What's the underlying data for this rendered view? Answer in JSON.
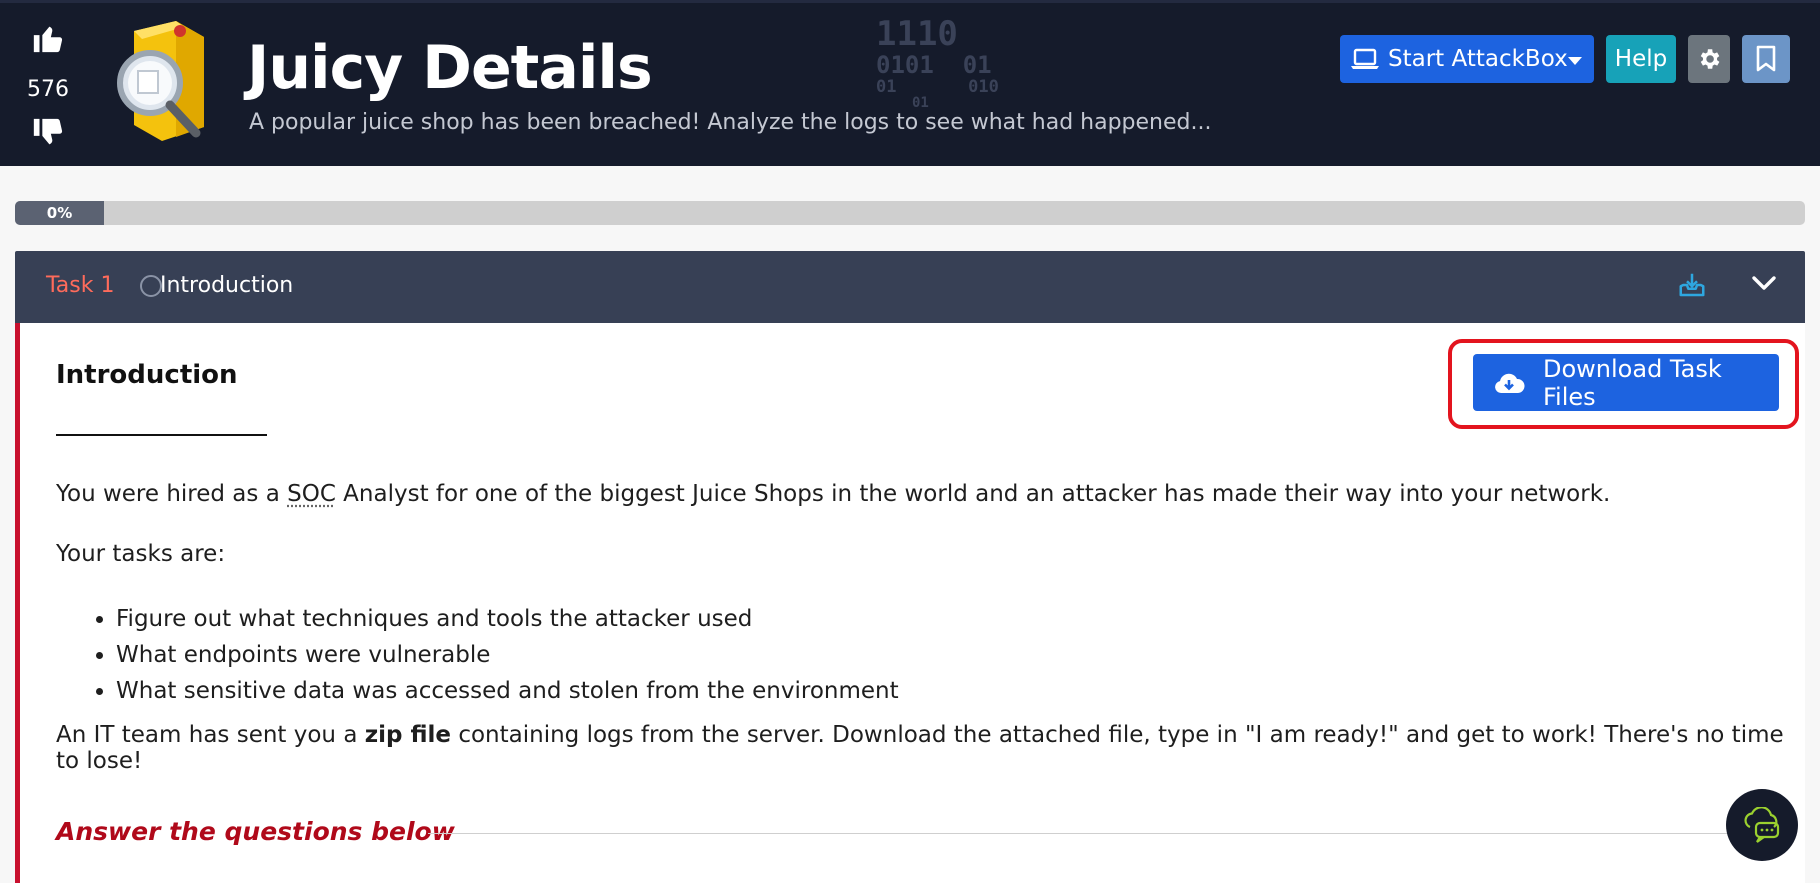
{
  "room": {
    "votes": "576",
    "title": "Juicy Details",
    "subtitle": "A popular juice shop has been breached! Analyze the logs to see what had happened...",
    "binary_art": [
      "1110",
      "0101  01",
      "01       010",
      "01"
    ]
  },
  "header_buttons": {
    "attackbox": "Start AttackBox",
    "help": "Help"
  },
  "progress": {
    "label": "0%",
    "value": 0
  },
  "task": {
    "number": "Task 1",
    "title": "Introduction",
    "heading": "Introduction",
    "download_label": "Download Task Files",
    "para1_before": "You were hired as a ",
    "para1_abbr": "SOC",
    "para1_after": " Analyst for one of the biggest Juice Shops in the world and an attacker has made their way into your network.",
    "para2": "Your tasks are:",
    "bullets": [
      "Figure out what techniques and tools the attacker used",
      "What endpoints were vulnerable",
      "What sensitive data was accessed and stolen from the environment"
    ],
    "para3_before": "An IT team has sent you a ",
    "para3_bold": "zip file",
    "para3_after": " containing logs from the server. Download the attached file, type in \"I am ready!\" and get to work! There's no time to lose!",
    "answer_heading": "Answer the questions below"
  },
  "colors": {
    "header_bg": "#151b2b",
    "primary_blue": "#1d63e0",
    "help_teal": "#17a2b8",
    "task_red": "#c8102e",
    "highlight_red": "#e3141e"
  },
  "icons": [
    "thumbs-up-icon",
    "thumbs-down-icon",
    "laptop-icon",
    "caret-down-icon",
    "gear-icon",
    "bookmark-icon",
    "download-tray-icon",
    "chevron-down-icon",
    "cloud-download-icon",
    "chat-icon"
  ]
}
